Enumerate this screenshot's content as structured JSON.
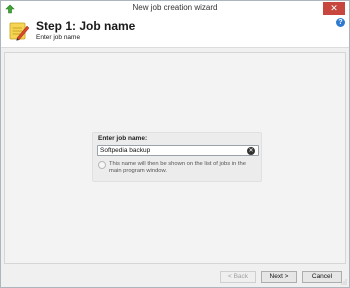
{
  "window": {
    "title": "New job creation wizard",
    "close_glyph": "✕"
  },
  "header": {
    "step_title": "Step 1: Job name",
    "step_subtitle": "Enter job name",
    "help_glyph": "?"
  },
  "form": {
    "field_label": "Enter job name:",
    "job_name_value": "Softpedia backup",
    "clear_glyph": "✕",
    "info_text": "This name will then be shown on the list of jobs in the main program window."
  },
  "footer": {
    "back_label": "< Back",
    "next_label": "Next >",
    "cancel_label": "Cancel"
  },
  "icons": {
    "app": "green-arrow-icon",
    "wizard": "note-pencil-icon",
    "help": "help-icon",
    "clear": "clear-input-icon",
    "info": "info-bulb-icon"
  },
  "colors": {
    "close_button": "#c7463d",
    "help_icon": "#2e7ad1"
  }
}
